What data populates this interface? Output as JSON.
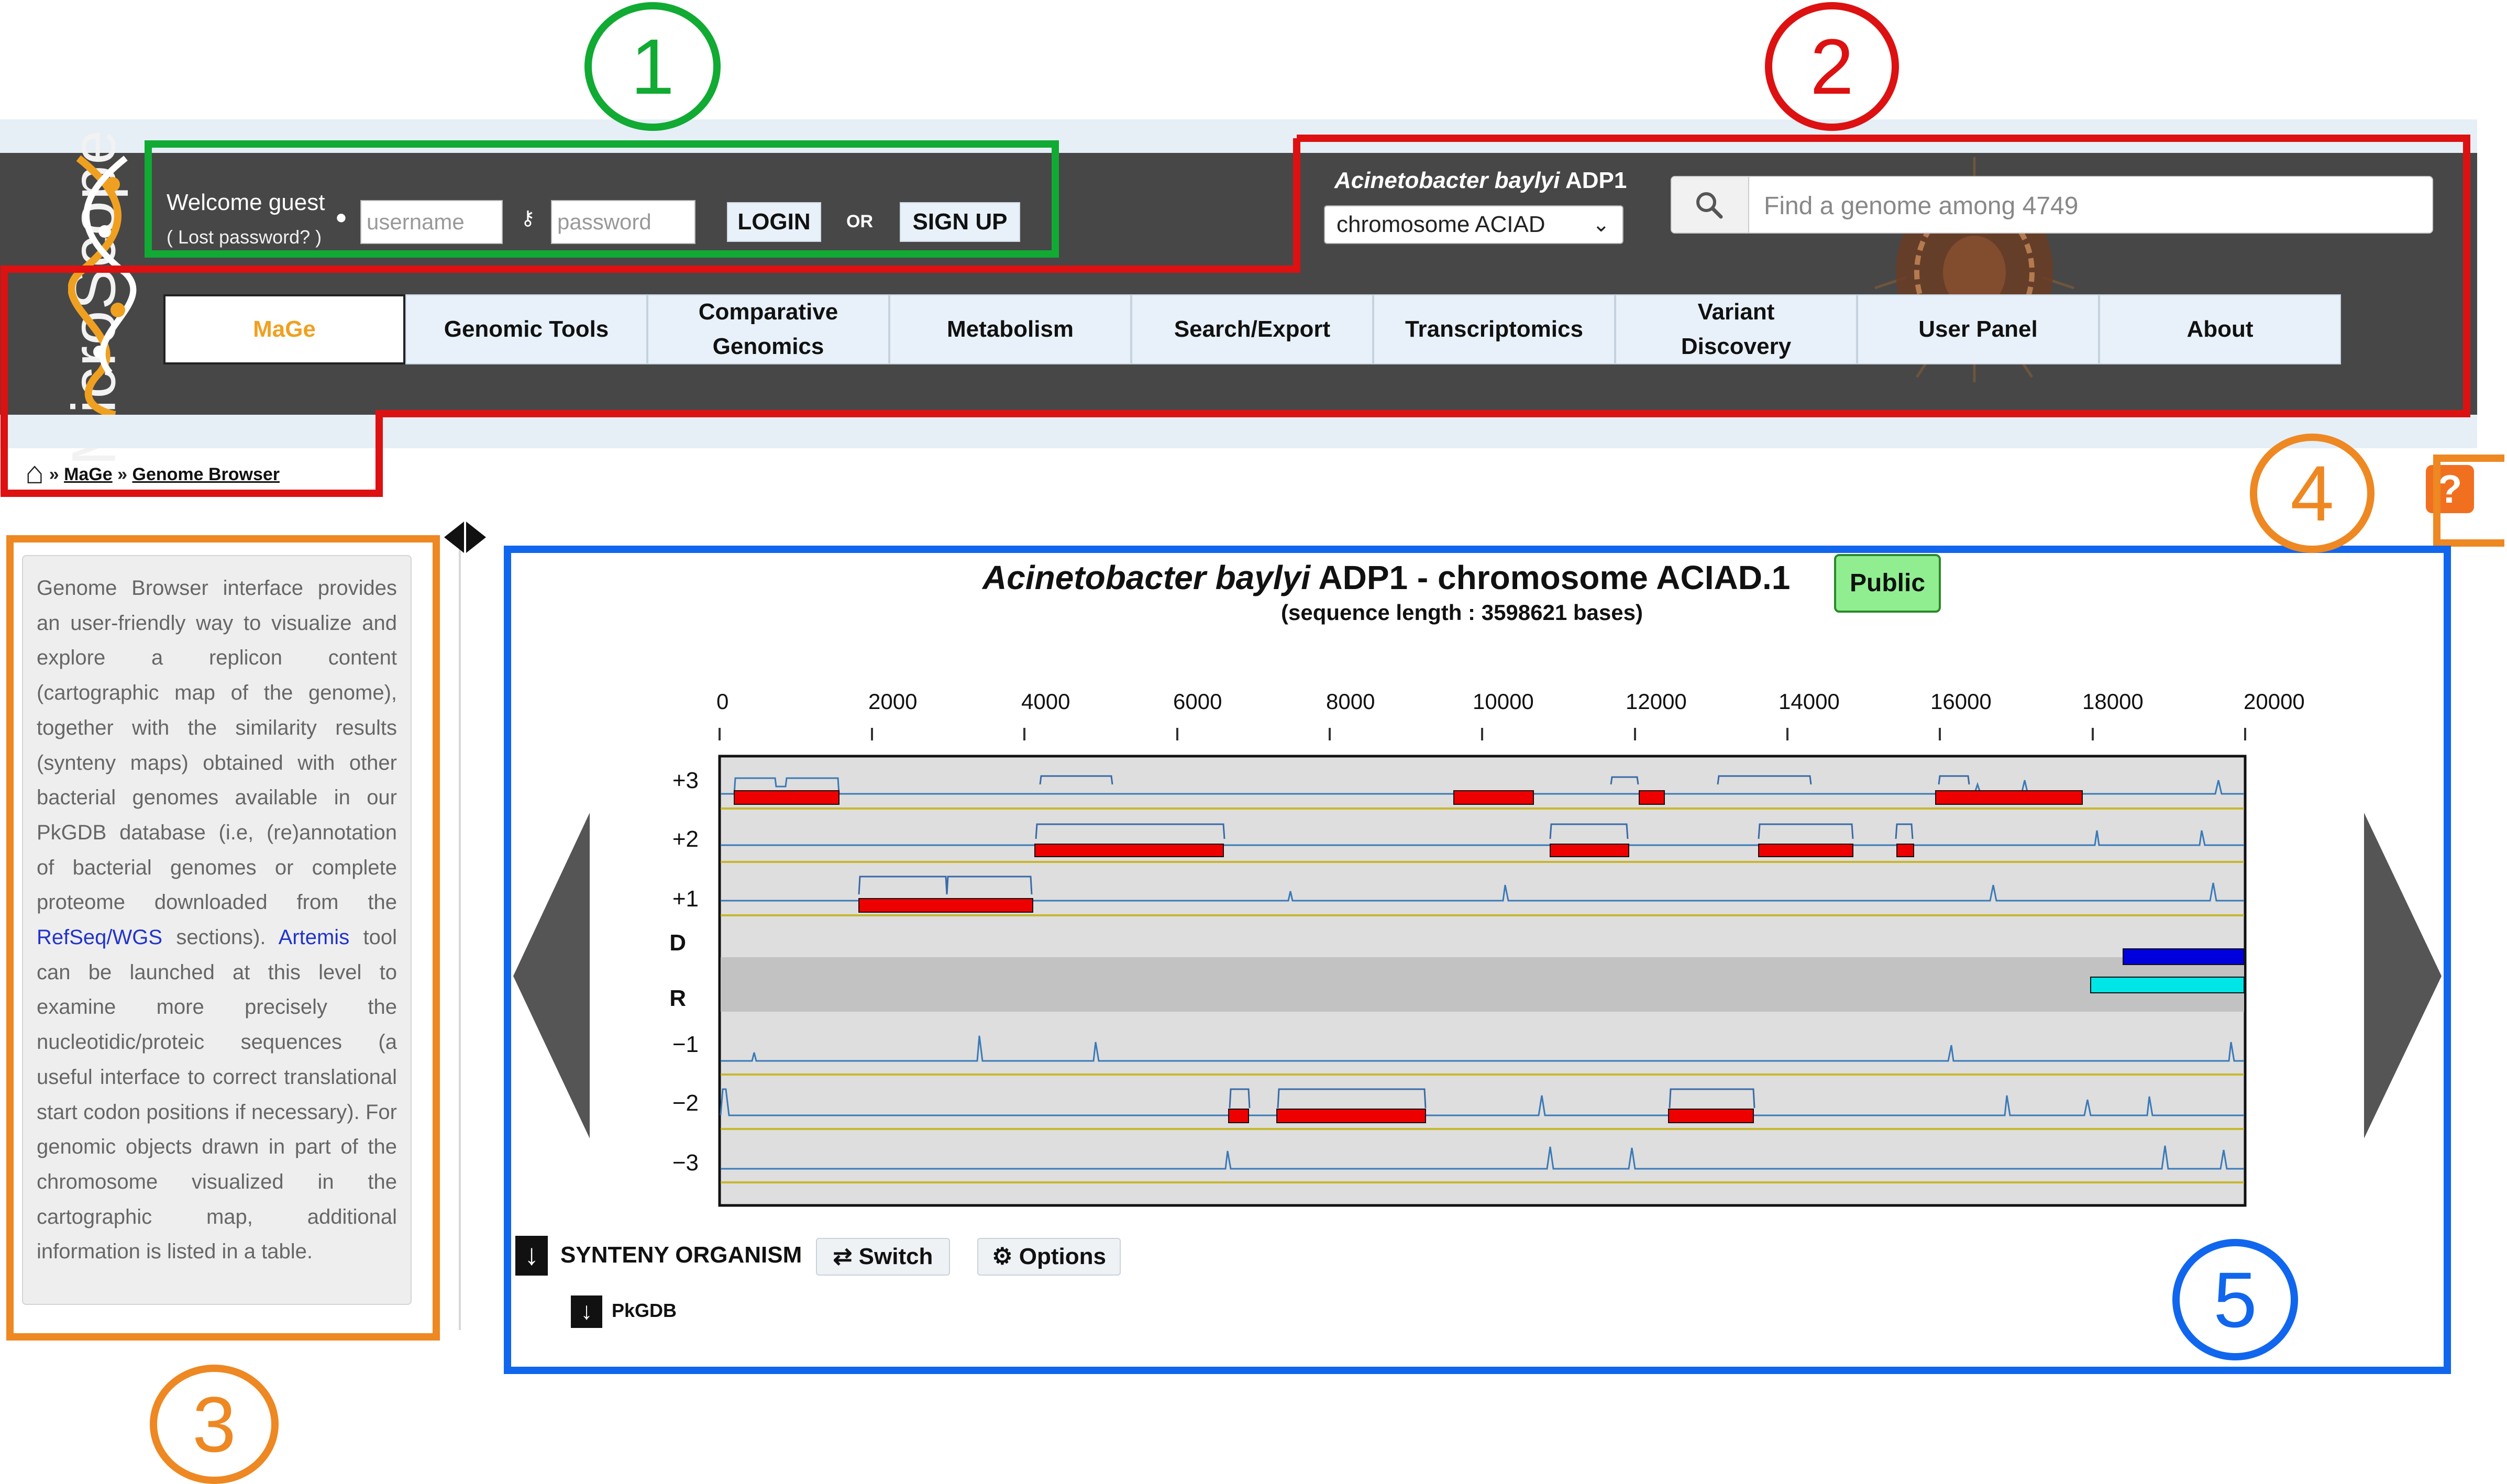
{
  "header": {
    "logo_text": "MicroScope",
    "welcome": "Welcome guest",
    "lost_password": "( Lost password? )",
    "username_placeholder": "username",
    "password_placeholder": "password",
    "login_label": "LOGIN",
    "or_label": "OR",
    "signup_label": "SIGN UP",
    "organism_name": "Acinetobacter baylyi",
    "organism_strain": " ADP1",
    "replicon_select": "chromosome ACIAD",
    "search_placeholder": "Find a genome among 4749"
  },
  "nav": {
    "items": [
      {
        "label": "MaGe",
        "active": true
      },
      {
        "label": "Genomic Tools"
      },
      {
        "label": "Comparative Genomics"
      },
      {
        "label": "Metabolism"
      },
      {
        "label": "Search/Export"
      },
      {
        "label": "Transcriptomics"
      },
      {
        "label": "Variant Discovery"
      },
      {
        "label": "User Panel"
      },
      {
        "label": "About"
      }
    ]
  },
  "breadcrumb": {
    "sep": "»",
    "items": [
      "MaGe",
      "Genome Browser"
    ]
  },
  "sidebar": {
    "text_1": "Genome Browser interface provides an user-friendly way to visualize and explore a replicon content (cartographic map of the genome), together with the similarity results (synteny maps) obtained with other bacterial genomes available in our PkGDB database (i.e, (re)annotation of bacterial genomes or complete proteome downloaded from the ",
    "link_1": "RefSeq/WGS",
    "text_2": " sections). ",
    "link_2": "Artemis",
    "text_3": " tool can be launched at this level to examine more precisely the nucleotidic/proteic sequences (a useful interface to correct translational start codon positions if necessary). For genomic objects drawn in part of the chromosome visualized in the cartographic map, additional information is listed in a table."
  },
  "browser": {
    "title_organism": "Acinetobacter baylyi",
    "title_rest": " ADP1 - chromosome ACIAD.1",
    "public_badge": "Public",
    "sequence_length": "(sequence length : 3598621 bases)",
    "axis_ticks": [
      "0",
      "2000",
      "4000",
      "6000",
      "8000",
      "10000",
      "12000",
      "14000",
      "16000",
      "18000",
      "20000"
    ],
    "frames": [
      "+3",
      "+2",
      "+1",
      "D",
      "R",
      "−1",
      "−2",
      "−3"
    ],
    "synteny_label": "SYNTENY ORGANISM",
    "switch_label": "Switch",
    "options_label": "Options",
    "pkgdb_label": "PkGDB"
  },
  "annotations": [
    "1",
    "2",
    "3",
    "4",
    "5"
  ],
  "help_icon": "question-mark-icon",
  "colors": {
    "header_bg": "#474747",
    "accent_orange": "#f0a020",
    "gene_red": "#ee0000",
    "signal_blue": "#3a7ab8",
    "synteny_blue": "#0000dd",
    "synteny_cyan": "#00e5e5",
    "ann_green": "#11aa33",
    "ann_red": "#dd1111",
    "ann_orange": "#ee8822",
    "ann_blue": "#1166ee"
  }
}
